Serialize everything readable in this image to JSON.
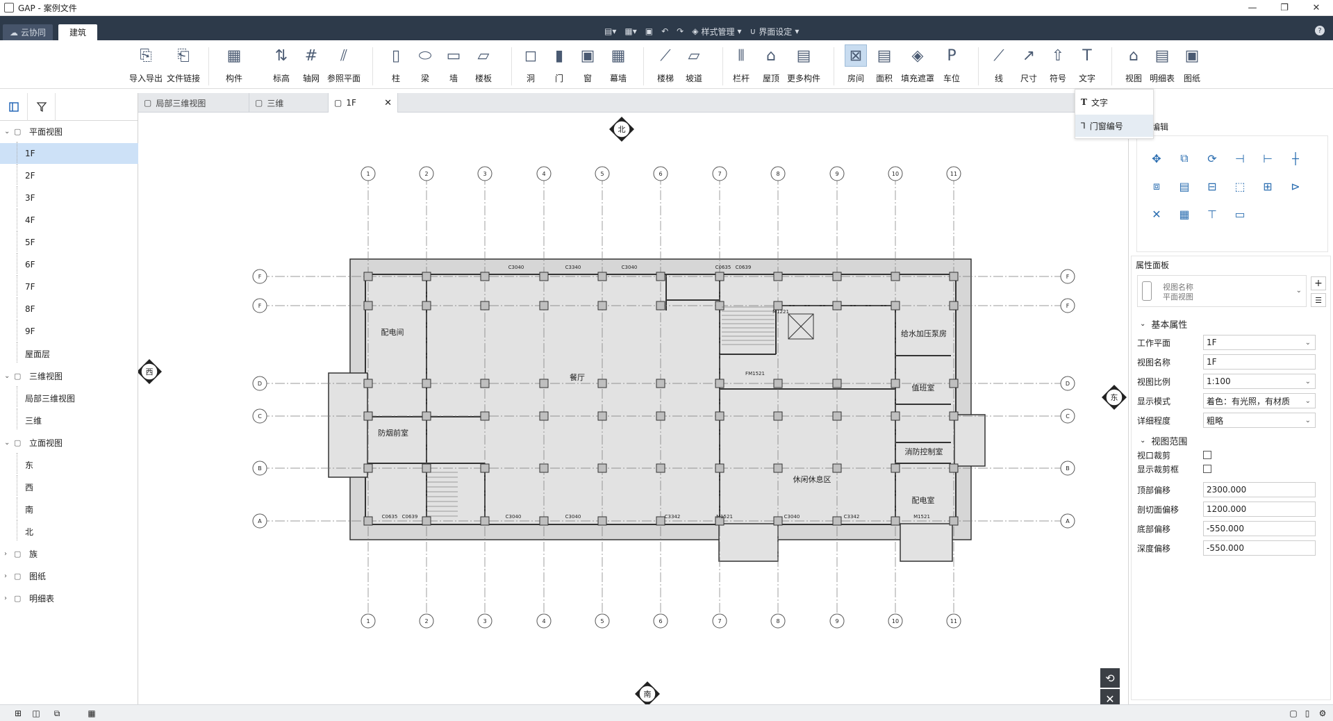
{
  "window": {
    "title": "GAP - 案例文件"
  },
  "menubar": {
    "tabs": [
      {
        "label": "云协同"
      },
      {
        "label": "建筑"
      }
    ],
    "style_manage": "样式管理",
    "ui_settings": "界面设定"
  },
  "ribbon": {
    "buttons": [
      "导入导出",
      "文件链接",
      "构件",
      "标高",
      "轴网",
      "参照平面",
      "柱",
      "梁",
      "墙",
      "楼板",
      "洞",
      "门",
      "窗",
      "幕墙",
      "楼梯",
      "坡道",
      "栏杆",
      "屋顶",
      "更多构件",
      "房间",
      "面积",
      "填充遮罩",
      "车位",
      "线",
      "尺寸",
      "符号",
      "文字",
      "视图",
      "明细表",
      "图纸"
    ]
  },
  "text_dropdown": {
    "items": [
      "文字",
      "门窗编号"
    ]
  },
  "sidebar": {
    "groups": [
      {
        "label": "平面视图",
        "items": [
          "1F",
          "2F",
          "3F",
          "4F",
          "5F",
          "6F",
          "7F",
          "8F",
          "9F",
          "屋面层"
        ]
      },
      {
        "label": "三维视图",
        "items": [
          "局部三维视图",
          "三维"
        ]
      },
      {
        "label": "立面视图",
        "items": [
          "东",
          "西",
          "南",
          "北"
        ]
      },
      {
        "label": "族",
        "items": []
      },
      {
        "label": "图纸",
        "items": []
      },
      {
        "label": "明细表",
        "items": []
      }
    ],
    "selected": "1F"
  },
  "doc_tabs": [
    {
      "label": "局部三维视图"
    },
    {
      "label": "三维"
    },
    {
      "label": "1F"
    }
  ],
  "modify_panel": {
    "title_suffix": "编辑"
  },
  "properties": {
    "title": "属性面板",
    "type_line1": "视图名称",
    "type_line2": "平面视图",
    "basic_section": "基本属性",
    "rows": [
      {
        "label": "工作平面",
        "value": "1F",
        "dropdown": true
      },
      {
        "label": "视图名称",
        "value": "1F",
        "dropdown": false
      },
      {
        "label": "视图比例",
        "value": "1:100",
        "dropdown": true
      },
      {
        "label": "显示模式",
        "value": "着色：有光照，有材质",
        "dropdown": true
      },
      {
        "label": "详细程度",
        "value": "粗略",
        "dropdown": true
      }
    ],
    "range_section": "视图范围",
    "checks": [
      {
        "label": "视口裁剪"
      },
      {
        "label": "显示裁剪框"
      }
    ],
    "offsets": [
      {
        "label": "顶部偏移",
        "value": "2300.000"
      },
      {
        "label": "剖切面偏移",
        "value": "1200.000"
      },
      {
        "label": "底部偏移",
        "value": "-550.000"
      },
      {
        "label": "深度偏移",
        "value": "-550.000"
      }
    ]
  },
  "drawing": {
    "compass": {
      "north": "北",
      "south": "南",
      "east": "东",
      "west": "西"
    },
    "grid_cols": [
      "1",
      "2",
      "3",
      "4",
      "5",
      "6",
      "7",
      "8",
      "9",
      "10",
      "11"
    ],
    "grid_rows": [
      "F",
      "F",
      "D",
      "C",
      "B",
      "A"
    ],
    "rooms": [
      "配电间",
      "餐厅",
      "给水加压泵房",
      "值班室",
      "防烟前室",
      "消防控制室",
      "休闲休息区",
      "配电室"
    ],
    "window_tags": [
      "C3040",
      "C3340",
      "C3040",
      "C0635",
      "C0639",
      "C0635",
      "C0639",
      "C3040",
      "C3040",
      "C3342",
      "C3040",
      "C3342",
      "FM1521",
      "M1521",
      "M1221",
      "M1521"
    ]
  }
}
